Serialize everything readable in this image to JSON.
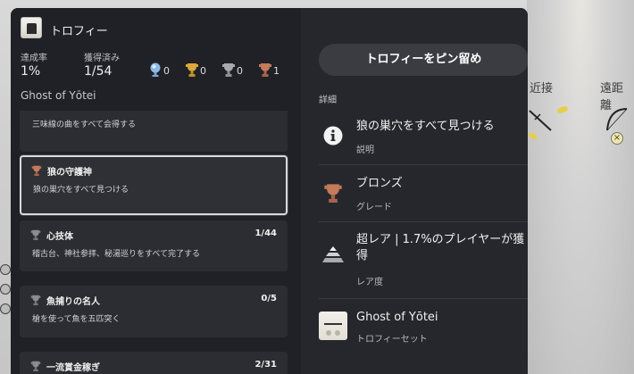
{
  "background": {
    "labels": {
      "kinsetsu": "近接",
      "enkyori": "遠距離"
    }
  },
  "header": {
    "title": "トロフィー"
  },
  "stats": {
    "rate_label": "達成率",
    "rate_value": "1%",
    "earned_label": "獲得済み",
    "earned_value": "1/54",
    "counts": {
      "platinum": "0",
      "gold": "0",
      "silver": "0",
      "bronze": "1"
    }
  },
  "game_name": "Ghost of Yōtei",
  "trophies": [
    {
      "name": "",
      "progress": "",
      "description": "三味線の曲をすべて会得する"
    },
    {
      "name": "狼の守護神",
      "progress": "",
      "description": "狼の巣穴をすべて見つける"
    },
    {
      "name": "心技体",
      "progress": "1/44",
      "description": "稽古台、神社参拝、秘湯巡りをすべて完了する"
    },
    {
      "name": "魚捕りの名人",
      "progress": "0/5",
      "description": "槍を使って魚を五匹突く"
    },
    {
      "name": "一流賞金稼ぎ",
      "progress": "2/31",
      "description": ""
    }
  ],
  "detail_panel": {
    "pin_button": "トロフィーをピン留め",
    "header": "詳細",
    "items": [
      {
        "icon": "info-icon",
        "main": "狼の巣穴をすべて見つける",
        "sub": "説明"
      },
      {
        "icon": "bronze-trophy-icon",
        "main": "ブロンズ",
        "sub": "グレード"
      },
      {
        "icon": "rarity-pyramid-icon",
        "main": "超レア | 1.7%のプレイヤーが獲得",
        "sub": "レア度"
      },
      {
        "icon": "game-cover-icon",
        "main": "Ghost of Yōtei",
        "sub": "トロフィーセット"
      }
    ]
  },
  "colors": {
    "panel_bg": "#1f2024",
    "right_bg": "#26272c",
    "row_bg": "#2c2d32",
    "bronze": "#c57a5a",
    "gold": "#d9a93a",
    "silver": "#a7a9ad",
    "platinum": "#8fb8e6"
  }
}
